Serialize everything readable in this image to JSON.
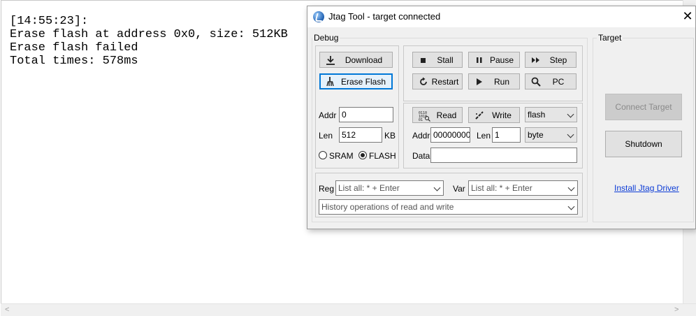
{
  "console": {
    "lines": [
      "[14:55:23]:",
      "Erase flash at address 0x0, size: 512KB",
      "Erase flash failed",
      "Total times: 578ms"
    ]
  },
  "window": {
    "title": "Jtag Tool - target connected",
    "close_symbol": "✕"
  },
  "debug": {
    "group_label": "Debug",
    "download_label": "Download",
    "erase_flash_label": "Erase Flash",
    "addr_label": "Addr",
    "addr_value": "0",
    "len_label": "Len",
    "len_value": "512",
    "len_unit": "KB",
    "sram_label": "SRAM",
    "flash_label": "FLASH",
    "selected_memory": "FLASH"
  },
  "controls": {
    "stall_label": "Stall",
    "pause_label": "Pause",
    "step_label": "Step",
    "restart_label": "Restart",
    "run_label": "Run",
    "pc_label": "PC"
  },
  "memory": {
    "read_label": "Read",
    "write_label": "Write",
    "target_select": "flash",
    "addr_label": "Addr",
    "addr_value": "00000000",
    "len_label": "Len",
    "len_value": "1",
    "unit_select": "byte",
    "data_label": "Data",
    "data_value": ""
  },
  "registers": {
    "reg_label": "Reg",
    "reg_placeholder": "List all:  * + Enter",
    "var_label": "Var",
    "var_placeholder": "List all:  * + Enter",
    "history_placeholder": "History operations of read and write"
  },
  "target": {
    "group_label": "Target",
    "connect_label": "Connect Target",
    "shutdown_label": "Shutdown",
    "install_driver_label": "Install Jtag Driver"
  },
  "icons": {
    "download": "download-icon",
    "erase": "broom-icon",
    "stall": "stop-icon",
    "pause": "pause-icon",
    "step": "step-icon",
    "restart": "restart-icon",
    "run": "play-icon",
    "pc": "magnifier-icon",
    "read": "binary-read-icon",
    "write": "write-icon"
  }
}
